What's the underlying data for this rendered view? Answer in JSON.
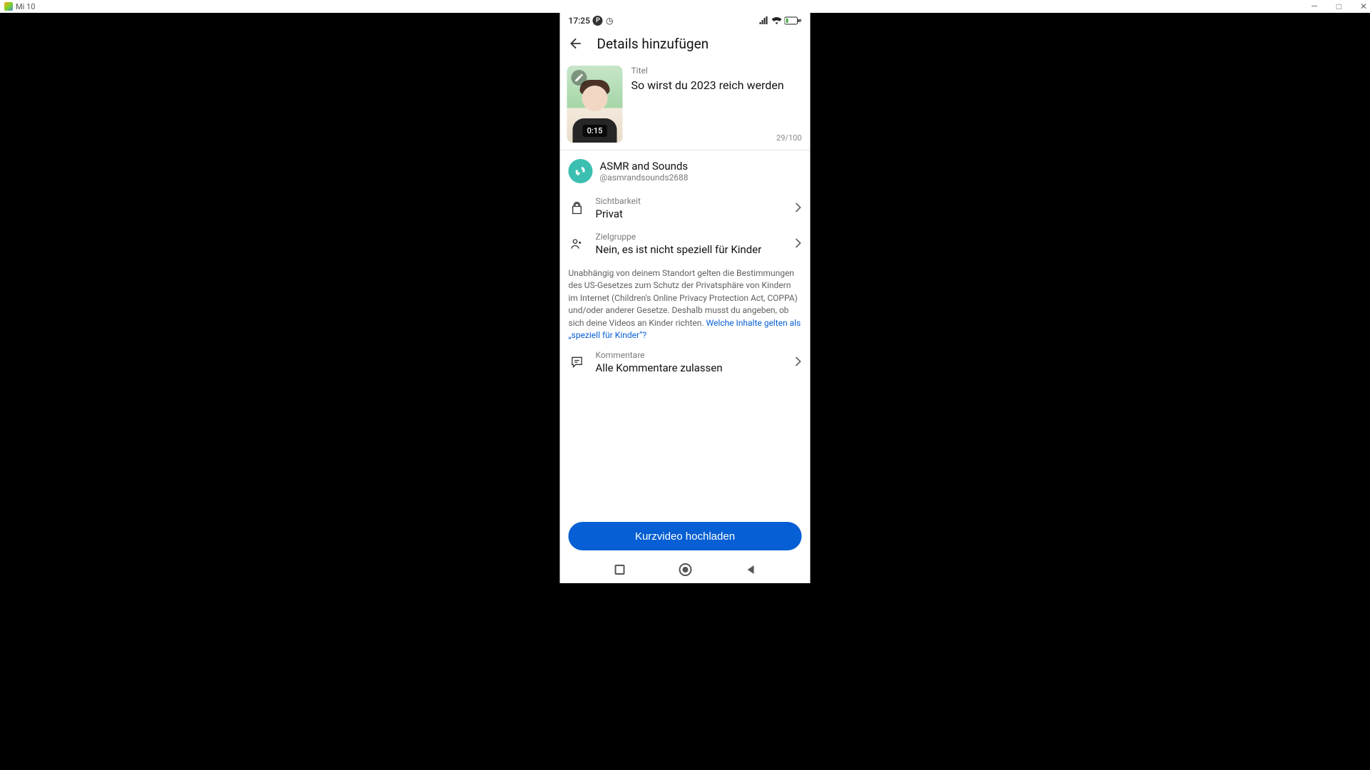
{
  "window": {
    "title": "Mi 10"
  },
  "status": {
    "time": "17:25",
    "battery_icon": "battery-charging",
    "p_icon": "P",
    "clock_icon": "◷"
  },
  "header": {
    "title": "Details hinzufügen"
  },
  "video": {
    "title_label": "Titel",
    "title_value": "So wirst du 2023 reich werden",
    "duration": "0:15",
    "char_count": "29/100"
  },
  "channel": {
    "name": "ASMR and Sounds",
    "handle": "@asmrandsounds2688"
  },
  "settings": {
    "visibility": {
      "label": "Sichtbarkeit",
      "value": "Privat"
    },
    "audience": {
      "label": "Zielgruppe",
      "value": "Nein, es ist nicht speziell für Kinder"
    },
    "comments": {
      "label": "Kommentare",
      "value": "Alle Kommentare zulassen"
    }
  },
  "coppa": {
    "text": "Unabhängig von deinem Standort gelten die Bestimmungen des US-Gesetzes zum Schutz der Privatsphäre von Kindern im Internet (Children's Online Privacy Protection Act, COPPA) und/oder anderer Gesetze. Deshalb musst du angeben, ob sich deine Videos an Kinder richten. ",
    "link": "Welche Inhalte gelten als „speziell für Kinder“?"
  },
  "upload": {
    "label": "Kurzvideo hochladen"
  }
}
